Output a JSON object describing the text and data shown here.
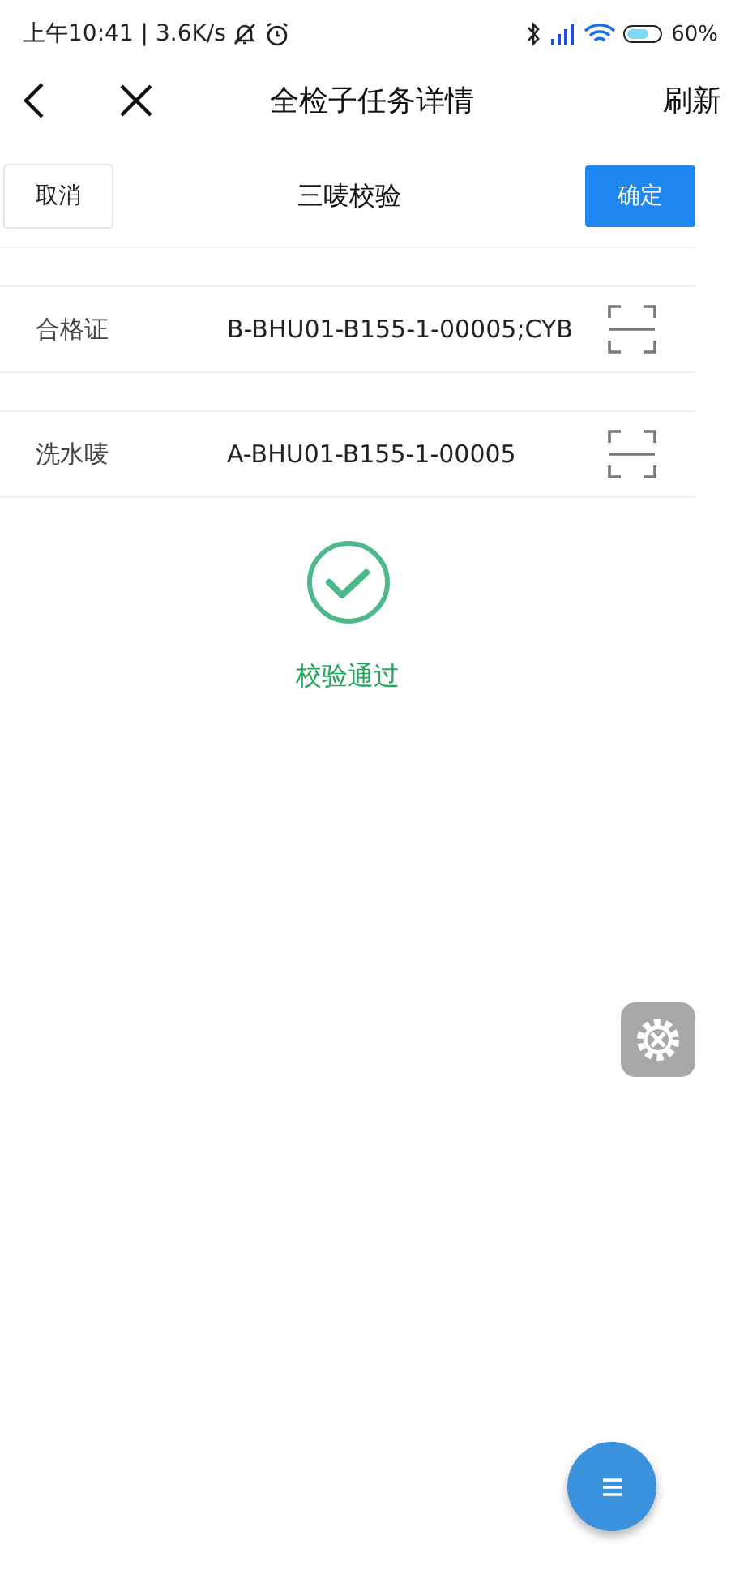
{
  "status_bar": {
    "left": "上午10:41 | 3.6K/s",
    "battery": "60%"
  },
  "nav": {
    "title": "全检子任务详情",
    "action": "刷新"
  },
  "actions": {
    "cancel": "取消",
    "title": "三唛校验",
    "confirm": "确定"
  },
  "fields": [
    {
      "label": "合格证",
      "value": "B-BHU01-B155-1-00005;CYB"
    },
    {
      "label": "洗水唛",
      "value": "A-BHU01-B155-1-00005"
    }
  ],
  "result": {
    "passed": true,
    "text": "校验通过"
  }
}
